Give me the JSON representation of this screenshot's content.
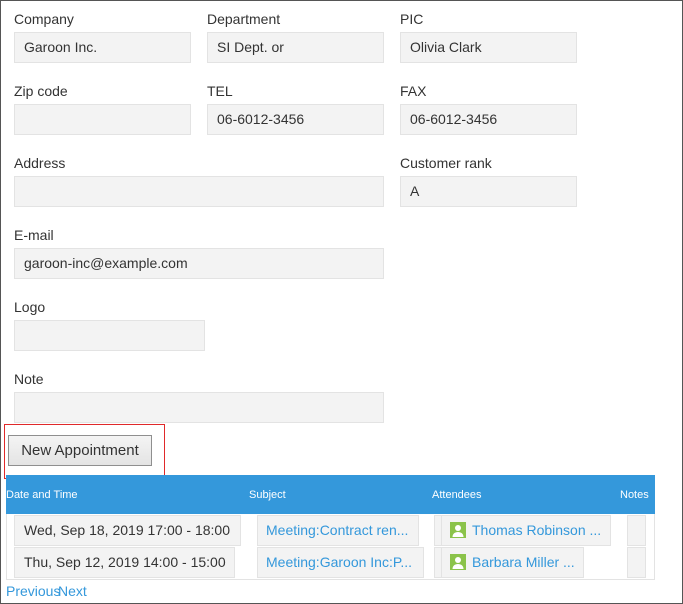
{
  "form": {
    "company": {
      "label": "Company",
      "value": "Garoon Inc."
    },
    "department": {
      "label": "Department",
      "value": "SI Dept. or"
    },
    "pic": {
      "label": "PIC",
      "value": "Olivia Clark"
    },
    "zip": {
      "label": "Zip code",
      "value": ""
    },
    "tel": {
      "label": "TEL",
      "value": "06-6012-3456"
    },
    "fax": {
      "label": "FAX",
      "value": "06-6012-3456"
    },
    "address": {
      "label": "Address",
      "value": ""
    },
    "rank": {
      "label": "Customer rank",
      "value": "A"
    },
    "email": {
      "label": "E-mail",
      "value": "garoon-inc@example.com"
    },
    "logo": {
      "label": "Logo",
      "value": ""
    },
    "note": {
      "label": "Note",
      "value": ""
    }
  },
  "new_appointment_label": "New Appointment",
  "table": {
    "headers": {
      "date": "Date and Time",
      "subject": "Subject",
      "attendees": "Attendees",
      "notes": "Notes"
    },
    "rows": [
      {
        "date": "Wed, Sep 18, 2019 17:00 - 18:00",
        "subject": "Meeting:Contract ren...",
        "attendee": "Thomas Robinson ..."
      },
      {
        "date": "Thu, Sep 12, 2019 14:00 - 15:00",
        "subject": "Meeting:Garoon Inc:P...",
        "attendee": "Barbara Miller ..."
      }
    ]
  },
  "pager": {
    "previous": "Previous",
    "next": "Next"
  },
  "colors": {
    "accent": "#3498db",
    "highlight": "#e0292a",
    "avatar": "#8bc34a"
  },
  "icons": {
    "attendee": "user-avatar-icon"
  }
}
